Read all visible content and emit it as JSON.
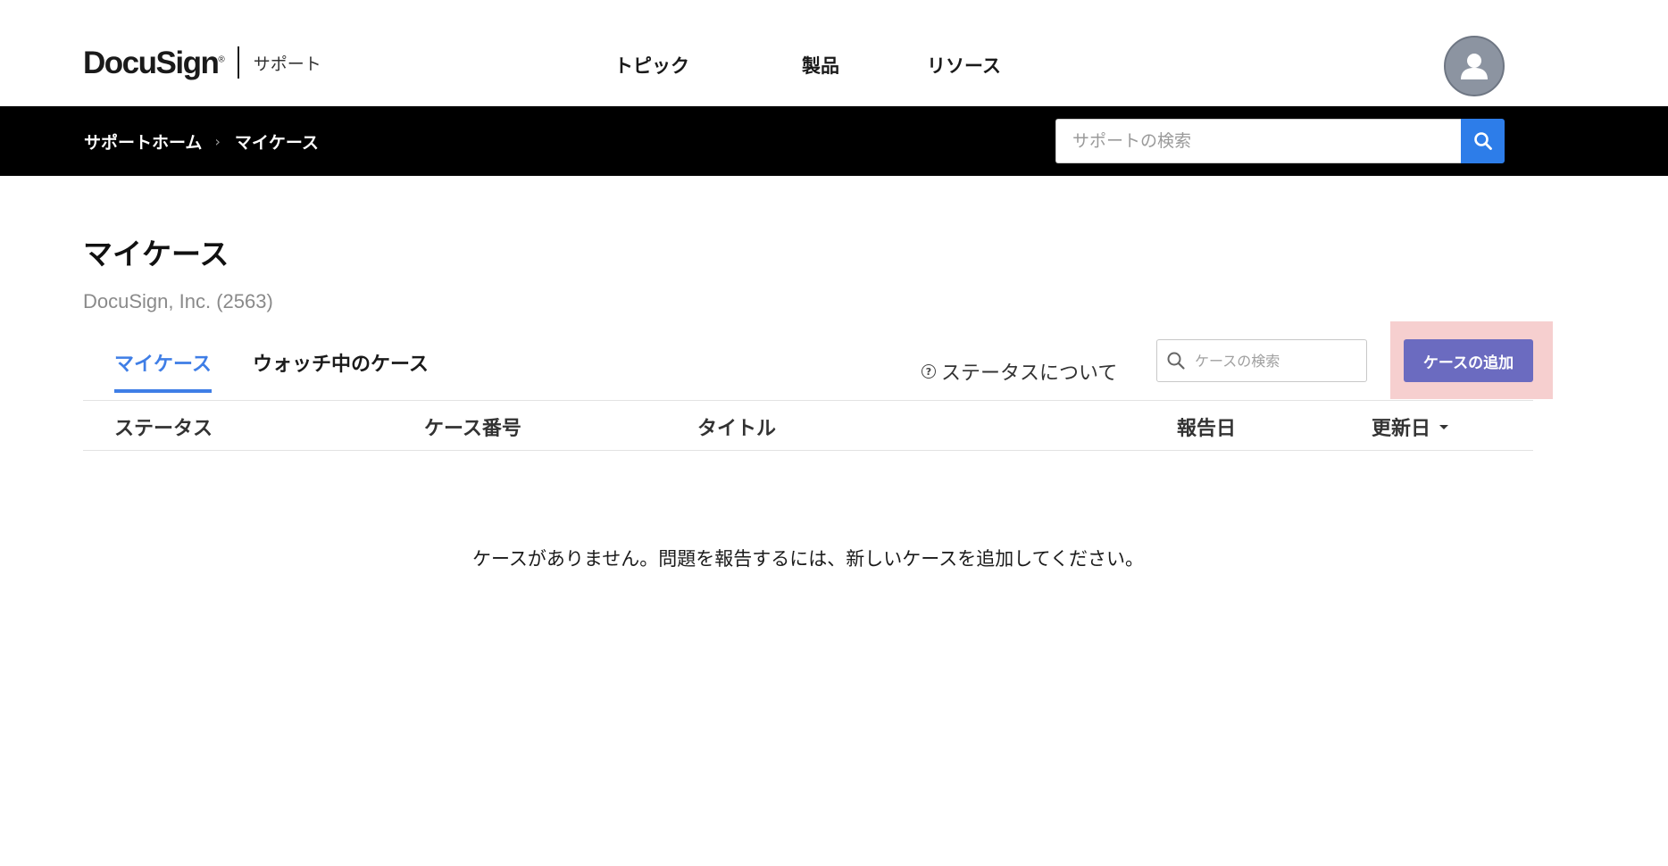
{
  "brand": {
    "logo_text": "DocuSign",
    "logo_mark": "®",
    "section": "サポート"
  },
  "top_nav": {
    "topics": "トピック",
    "products": "製品",
    "resources": "リソース"
  },
  "breadcrumb": {
    "home": "サポートホーム",
    "separator": "›",
    "current": "マイケース"
  },
  "global_search": {
    "placeholder": "サポートの検索"
  },
  "main": {
    "title": "マイケース",
    "account": "DocuSign, Inc. (2563)",
    "tabs": [
      {
        "label": "マイケース",
        "active": true
      },
      {
        "label": "ウォッチ中のケース",
        "active": false
      }
    ],
    "status_help": "ステータスについて",
    "case_search_placeholder": "ケースの検索",
    "add_case": "ケースの追加",
    "columns": {
      "status": "ステータス",
      "number": "ケース番号",
      "title": "タイトル",
      "reported": "報告日",
      "updated": "更新日"
    },
    "empty_message": "ケースがありません。問題を報告するには、新しいケースを追加してください。"
  },
  "colors": {
    "accent_blue": "#3f7ee6",
    "search_button": "#2d7de9",
    "add_button": "#6b6bc0",
    "highlight": "#f6cfcf",
    "subbar": "#000000"
  }
}
